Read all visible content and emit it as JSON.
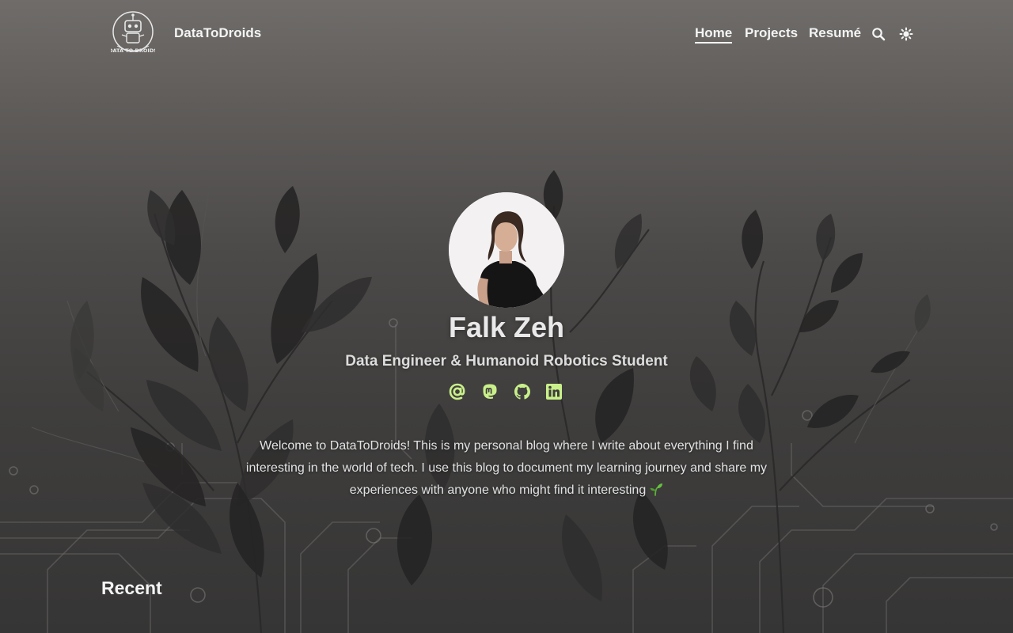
{
  "header": {
    "site_title": "DataToDroids",
    "logo_icon": "robot-logo-icon",
    "logo_text": "DATA TO DROIDS"
  },
  "nav": {
    "items": [
      {
        "label": "Home",
        "active": true
      },
      {
        "label": "Projects",
        "active": false
      },
      {
        "label": "Resumé",
        "active": false
      }
    ],
    "search_icon": "search-icon",
    "theme_icon": "theme-toggle-icon"
  },
  "profile": {
    "name": "Falk Zeh",
    "subtitle": "Data Engineer & Humanoid Robotics Student",
    "socials": [
      {
        "icon": "email-icon"
      },
      {
        "icon": "mastodon-icon"
      },
      {
        "icon": "github-icon"
      },
      {
        "icon": "linkedin-icon"
      }
    ],
    "accent_color": "#c9f08a",
    "intro": "Welcome to DataToDroids! This is my personal blog where I write about everything I find interesting in the world of tech. I use this blog to document my learning journey and share my experiences with anyone who might find it interesting",
    "intro_emoji": "sprout-icon"
  },
  "sections": {
    "recent_heading": "Recent"
  }
}
